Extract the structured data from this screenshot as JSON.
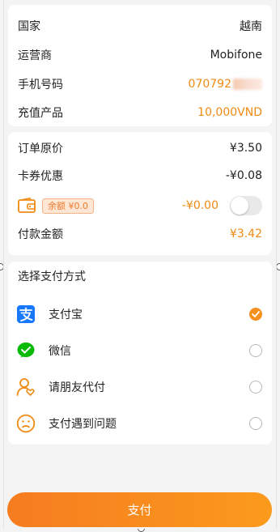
{
  "order": {
    "country_label": "国家",
    "country_value": "越南",
    "carrier_label": "运营商",
    "carrier_value": "Mobifone",
    "phone_label": "手机号码",
    "phone_value": "070792",
    "product_label": "充值产品",
    "product_value": "10,000VND"
  },
  "pricing": {
    "original_label": "订单原价",
    "original_value": "¥3.50",
    "coupon_label": "卡券优惠",
    "coupon_value": "-¥0.08",
    "balance_badge": "余额 ¥0.0",
    "balance_deduct": "-¥0.00",
    "balance_toggle_on": false,
    "pay_amount_label": "付款金额",
    "pay_amount_value": "¥3.42"
  },
  "payment": {
    "title": "选择支付方式",
    "methods": [
      {
        "label": "支付宝",
        "icon": "alipay-icon",
        "selected": true
      },
      {
        "label": "微信",
        "icon": "wechat-icon",
        "selected": false
      },
      {
        "label": "请朋友代付",
        "icon": "friend-pay-icon",
        "selected": false
      },
      {
        "label": "支付遇到问题",
        "icon": "sad-face-icon",
        "selected": false
      }
    ]
  },
  "pay_button_label": "支付",
  "colors": {
    "accent": "#f5901e",
    "alipay_blue": "#1677ff",
    "wechat_green": "#09bb07"
  }
}
